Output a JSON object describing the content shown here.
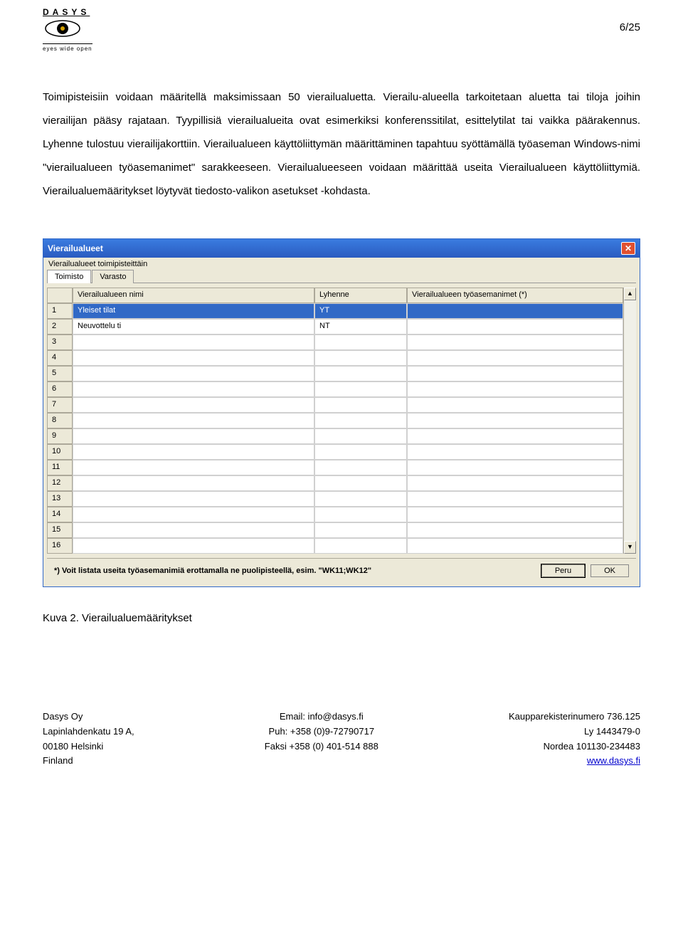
{
  "page": {
    "number": "6/25",
    "logo_text": "DASYS",
    "logo_sub": "eyes wide open"
  },
  "text": {
    "body": "Toimipisteisiin voidaan määritellä maksimissaan 50 vierailualuetta. Vierailu-alueella tarkoitetaan aluetta tai tiloja joihin vierailijan pääsy rajataan. Tyypillisiä vierailualueita ovat esimerkiksi konferenssitilat, esittelytilat tai vaikka päärakennus. Lyhenne tulostuu vierailijakorttiin. Vierailualueen käyttöliittymän määrittäminen tapahtuu syöttämällä työaseman Windows-nimi \"vierailualueen työasemanimet\" sarakkeeseen. Vierailualueeseen voidaan määrittää useita Vierailualueen käyttöliittymiä. Vierailualuemääritykset löytyvät tiedosto-valikon asetukset -kohdasta."
  },
  "dialog": {
    "title": "Vierailualueet",
    "group_label": "Vierailualueet toimipisteittäin",
    "tabs": [
      "Toimisto",
      "Varasto"
    ],
    "columns": {
      "name": "Vierailualueen nimi",
      "abbr": "Lyhenne",
      "ws": "Vierailualueen työasemanimet (*)"
    },
    "rows": [
      {
        "num": "1",
        "name": "Yleiset tilat",
        "abbr": "YT",
        "ws": "",
        "selected": true
      },
      {
        "num": "2",
        "name": "Neuvottelu ti",
        "abbr": "NT",
        "ws": "",
        "selected": false
      },
      {
        "num": "3",
        "name": "",
        "abbr": "",
        "ws": ""
      },
      {
        "num": "4",
        "name": "",
        "abbr": "",
        "ws": ""
      },
      {
        "num": "5",
        "name": "",
        "abbr": "",
        "ws": ""
      },
      {
        "num": "6",
        "name": "",
        "abbr": "",
        "ws": ""
      },
      {
        "num": "7",
        "name": "",
        "abbr": "",
        "ws": ""
      },
      {
        "num": "8",
        "name": "",
        "abbr": "",
        "ws": ""
      },
      {
        "num": "9",
        "name": "",
        "abbr": "",
        "ws": ""
      },
      {
        "num": "10",
        "name": "",
        "abbr": "",
        "ws": ""
      },
      {
        "num": "11",
        "name": "",
        "abbr": "",
        "ws": ""
      },
      {
        "num": "12",
        "name": "",
        "abbr": "",
        "ws": ""
      },
      {
        "num": "13",
        "name": "",
        "abbr": "",
        "ws": ""
      },
      {
        "num": "14",
        "name": "",
        "abbr": "",
        "ws": ""
      },
      {
        "num": "15",
        "name": "",
        "abbr": "",
        "ws": ""
      },
      {
        "num": "16",
        "name": "",
        "abbr": "",
        "ws": ""
      }
    ],
    "hint": "*) Voit listata useita työasemanimiä erottamalla ne puolipisteellä, esim. \"WK11;WK12\"",
    "buttons": {
      "cancel": "Peru",
      "ok": "OK"
    }
  },
  "caption": "Kuva 2. Vierailualuemääritykset",
  "footer": {
    "left": [
      "Dasys Oy",
      "Lapinlahdenkatu 19 A,",
      "00180 Helsinki",
      "Finland"
    ],
    "center": [
      "",
      "Email: info@dasys.fi",
      "Puh: +358 (0)9-72790717",
      "Faksi +358 (0) 401-514 888"
    ],
    "right": [
      "Kaupparekisterinumero 736.125",
      "Ly 1443479-0",
      "Nordea 101130-234483",
      "www.dasys.fi"
    ]
  }
}
